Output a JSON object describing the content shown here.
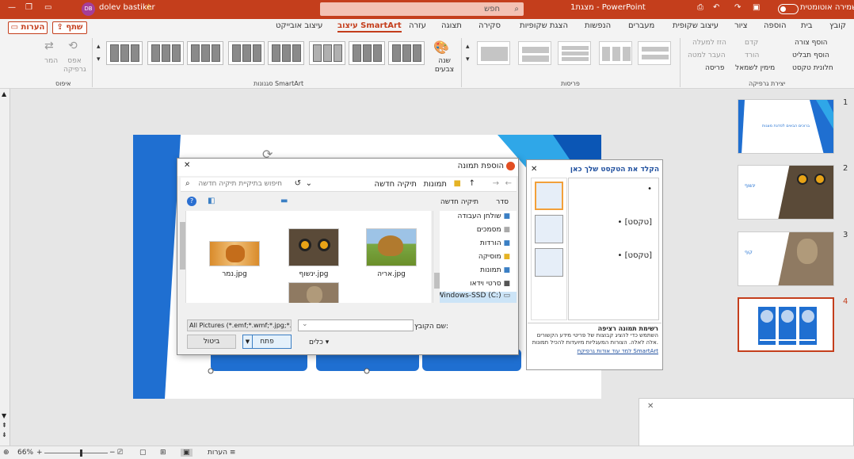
{
  "titlebar": {
    "autosave": "שמירה אוטומטית",
    "doc_title": "מצגת1 - PowerPoint",
    "search_placeholder": "חפש",
    "user_name": "dolev bastiker",
    "user_initials": "DB",
    "warning": "⚠"
  },
  "tabs": [
    "קובץ",
    "בית",
    "הוספה",
    "ציור",
    "עיצוב שקופית",
    "מעברים",
    "הנפשות",
    "הצגת שקופיות",
    "סקירה",
    "תצוגה",
    "עזרה",
    "עיצוב SmartArt",
    "עיצוב אובייקט"
  ],
  "share_label": "שתף",
  "comments_label": "הערות",
  "ribbon": {
    "create_graphic": {
      "label": "יצירת גרפיקה",
      "add_shape": "הוסף צורה",
      "add_bullet": "הוסף תבליט",
      "text_pane": "חלונית טקסט",
      "promote": "קדם",
      "demote": "הורד",
      "rtl": "מימין לשמאל",
      "layout": "פריסה",
      "move_up": "הזז למעלה",
      "move_down": "העבר למטה"
    },
    "layouts_label": "פריסות",
    "change_colors": "שנה צבעים",
    "styles_label": "סגנונות SmartArt",
    "reset": {
      "label": "איפוס",
      "reset_graphic": "אפס גרפיקה",
      "convert": "המר"
    }
  },
  "dialog": {
    "title": "הוספת תמונה",
    "breadcrumb_1": "תמונות",
    "breadcrumb_2": "תיקיה חדשה",
    "search_placeholder": "חיפוש בתיקיית תיקיה חדשה",
    "organize": "סדר",
    "new_folder": "תיקיה חדשה",
    "nav_items": [
      "שולחן העבודה",
      "מסמכים",
      "הורדות",
      "מוסיקה",
      "תמונות",
      "סרטי וידאו",
      "Windows-SSD (C:)"
    ],
    "files": [
      {
        "name": "אריה.jpg",
        "kind": "lion"
      },
      {
        "name": "ינשוף.jpg",
        "kind": "owl"
      },
      {
        "name": "נמר.jpg",
        "kind": "tiger"
      },
      {
        "name": "",
        "kind": "monkey"
      }
    ],
    "filename_label": "שם הקובץ:",
    "filetype": "All Pictures (*.emf;*.wmf;*.jpg;*.j",
    "tools_label": "כלים",
    "open_label": "פתח",
    "cancel_label": "ביטול"
  },
  "textpane": {
    "title": "הקלד את הטקסט שלך כאן",
    "bullets": [
      "",
      "[טקסט]",
      "[טקסט]"
    ],
    "desc_title": "רשימת תמונה רציפה",
    "desc_body": "השתמש כדי להציג קבוצות של פריטי מידע הקשורים אלה לאלה. הצורות המעגליות מיועדות להכיל תמונות.",
    "learn_more": "למד עוד אודות גרפיקת SmartArt"
  },
  "thumbnails": [
    {
      "num": "1",
      "caption": "ברוכים הבאים לסדנת מצגות"
    },
    {
      "num": "2",
      "caption": "ינשוף"
    },
    {
      "num": "3",
      "caption": "קוף"
    },
    {
      "num": "4",
      "caption": ""
    }
  ],
  "status": {
    "notes": "הערות",
    "zoom": "66%"
  },
  "colors": {
    "accent": "#c43e1c",
    "slide_blue": "#1f6fd1"
  }
}
